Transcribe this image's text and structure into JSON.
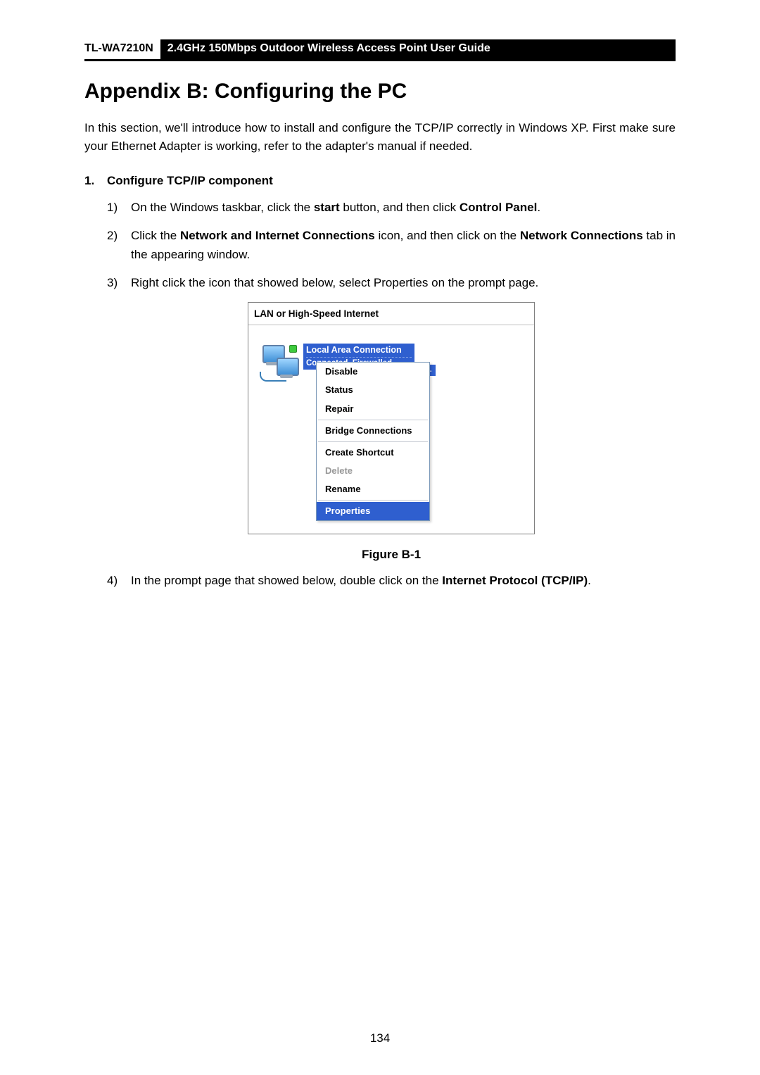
{
  "header": {
    "model": "TL-WA7210N",
    "title": "2.4GHz 150Mbps Outdoor Wireless Access Point User Guide"
  },
  "title": "Appendix B: Configuring the PC",
  "intro": "In this section, we'll introduce how to install and configure the TCP/IP correctly in Windows XP. First make sure your Ethernet Adapter is working, refer to the adapter's manual if needed.",
  "step1_number": "1.",
  "step1_heading": "Configure TCP/IP component",
  "sub1_marker": "1)",
  "sub1_prefix": "On the Windows taskbar, click the ",
  "sub1_b1": "start",
  "sub1_mid": " button, and then click ",
  "sub1_b2": "Control Panel",
  "sub1_suffix": ".",
  "sub2_marker": "2)",
  "sub2_prefix": "Click the ",
  "sub2_b1": "Network and Internet Connections",
  "sub2_mid": " icon, and then click on the ",
  "sub2_b2": "Network Connections",
  "sub2_suffix": " tab in the appearing window.",
  "sub3_marker": "3)",
  "sub3_text": "Right click the icon that showed below, select Properties on the prompt page.",
  "xp": {
    "group": "LAN or High-Speed Internet",
    "conn_line1": "Local  Area Connection",
    "conn_line2": "Connected, Firewalled",
    "menu": {
      "disable": "Disable",
      "status": "Status",
      "repair": "Repair",
      "bridge": "Bridge Connections",
      "create_shortcut": "Create Shortcut",
      "delete": "Delete",
      "rename": "Rename",
      "properties": "Properties"
    }
  },
  "fig_caption": "Figure B-1",
  "sub4_marker": "4)",
  "sub4_prefix": "In the prompt page that showed below, double click on the ",
  "sub4_b1": "Internet Protocol (TCP/IP)",
  "sub4_suffix": ".",
  "page_number": "134"
}
